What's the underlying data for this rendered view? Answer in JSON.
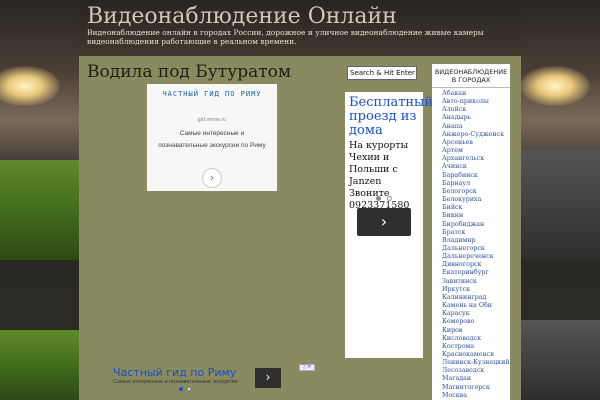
{
  "site": {
    "title": "Видеонаблюдение Онлайн",
    "description": "Видеонаблюдение онлайн в городах России, дорожное и уличное видеонаблюдение живые камеры видеонаблюдения работающие в реальном времени."
  },
  "post": {
    "title": "Водила под Бутуратом"
  },
  "ad_top": {
    "title": "ЧАСТНЫЙ ГИД ПО РИМУ",
    "url": "gid.vrime.ru",
    "text": "Самые интересные и познавательные экскурсии по Риму",
    "arrow": "›"
  },
  "ad_bottom": {
    "title": "Частный гид по Риму",
    "text": "Самые интересные и познавательные экскурсии",
    "arrow": "›",
    "badge": "ⓘ✕"
  },
  "search": {
    "value": "Search & Hit Enter"
  },
  "ad_side": {
    "headline": "Бесплатный проезд из дома",
    "body": "На курорты Чехии и Польши с Janzen Звоните 0923371580",
    "arrow": "›"
  },
  "cities": {
    "title": "ВИДЕОНАБЛЮДЕНИЕ В ГОРОДАХ",
    "items": [
      "Абакан",
      "Авто-приколы",
      "Алейск",
      "Анадырь",
      "Анапа",
      "Анжеро-Судженск",
      "Арсеньев",
      "Артем",
      "Архангельск",
      "Ачинск",
      "Барабинск",
      "Барнаул",
      "Белогорск",
      "Белокуриха",
      "Бийск",
      "Бикин",
      "Биробиджан",
      "Братск",
      "Владимир",
      "Дальнегорск",
      "Дальнереченск",
      "Дивногорск",
      "Екатеринбург",
      "Завитинск",
      "Иркутск",
      "Калининград",
      "Камень на Оби",
      "Карасук",
      "Кемерово",
      "Киров",
      "Кисловодск",
      "Кострома",
      "Краснокаменск",
      "Ленинск-Кузнецкий",
      "Лесозаводск",
      "Магадан",
      "Магнитогорск",
      "Москва"
    ]
  },
  "colors": {
    "content_bg": "#8a8a60",
    "link": "#2a4fa0",
    "ad_blue": "#1a4fc8"
  }
}
